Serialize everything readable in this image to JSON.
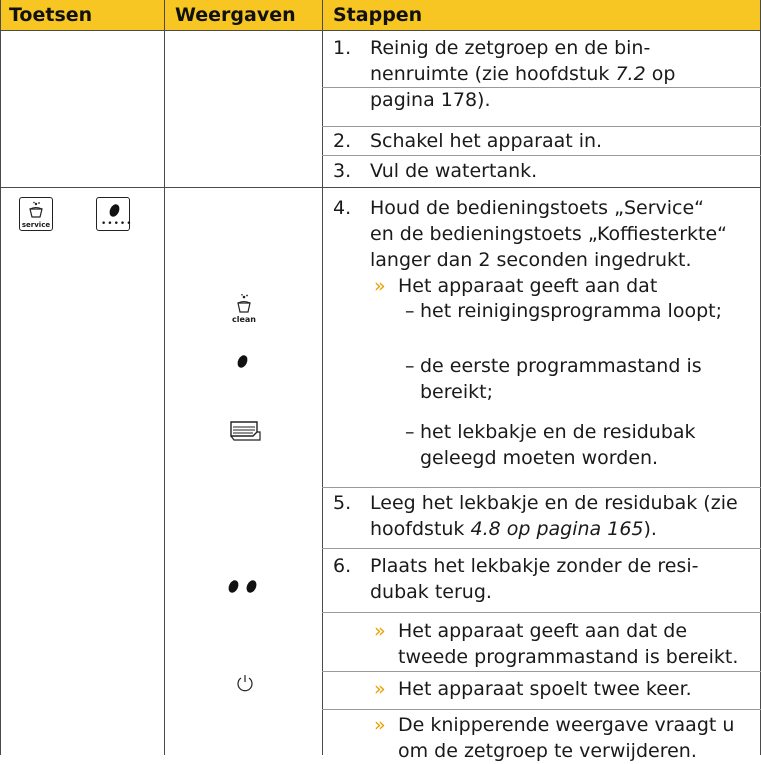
{
  "header": {
    "col1": "Toetsen",
    "col2": "Weergaven",
    "col3": "Stappen"
  },
  "steps": {
    "s1": {
      "num": "1.",
      "l1": "Reinig de zetgroep en de bin-",
      "l2a": "nenruimte (zie hoofdstuk ",
      "l2b": "7.2",
      "l2c": " op",
      "l3": "pagina 178)."
    },
    "s2": {
      "num": "2.",
      "text": "Schakel het apparaat in."
    },
    "s3": {
      "num": "3.",
      "text": "Vul de watertank."
    },
    "s4": {
      "num": "4.",
      "l1": "Houd de bedieningstoets „Service“",
      "l2": "en de bedieningstoets „Koffiesterkte“",
      "l3": "langer dan 2 seconden ingedrukt."
    },
    "r4": {
      "arrow": "»",
      "text": "Het apparaat geeft aan dat"
    },
    "d1": {
      "dash": "–",
      "text": "het reinigingsprogramma loopt;"
    },
    "d2": {
      "dash": "–",
      "l1": "de eerste programmastand is",
      "l2": "bereikt;"
    },
    "d3": {
      "dash": "–",
      "l1": "het lekbakje en de residubak",
      "l2": "geleegd moeten worden."
    },
    "s5": {
      "num": "5.",
      "l1": "Leeg het lekbakje en de residubak (zie",
      "l2a": "hoofdstuk ",
      "l2b": "4.8 op pagina 165",
      "l2c": ")."
    },
    "s6": {
      "num": "6.",
      "l1": "Plaats het lekbakje zonder de resi-",
      "l2": "dubak terug."
    },
    "r6a": {
      "arrow": "»",
      "l1": "Het apparaat geeft aan dat de",
      "l2": "tweede programmastand is bereikt."
    },
    "r6b": {
      "arrow": "»",
      "text": "Het apparaat spoelt twee keer."
    },
    "r6c": {
      "arrow": "»",
      "l1": "De knipperende weergave vraagt u",
      "l2": "om de zetgroep te verwijderen."
    }
  },
  "keys": {
    "service_label": "service"
  },
  "displays": {
    "clean_label": "clean"
  },
  "colors": {
    "header_bg": "#f7c623",
    "arrow": "#e8a000"
  }
}
